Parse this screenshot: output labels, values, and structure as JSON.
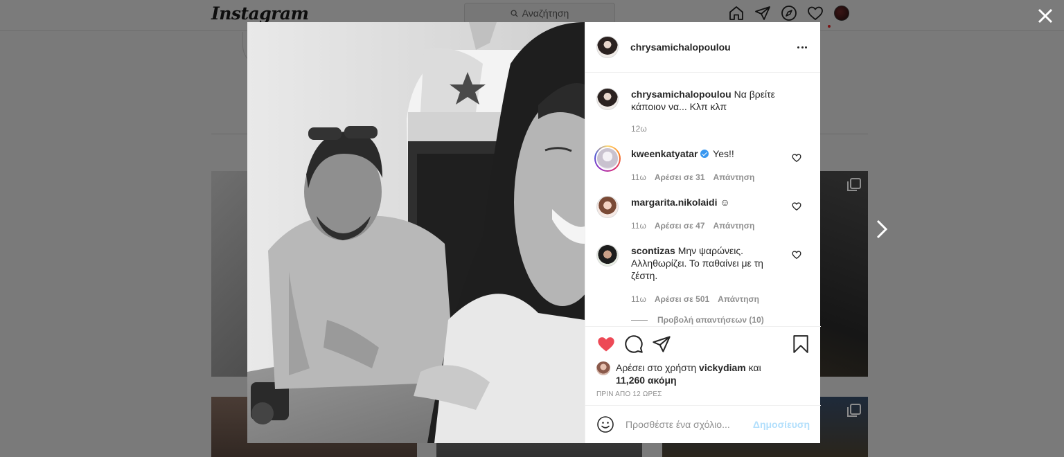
{
  "app": {
    "logo": "Instagram"
  },
  "search": {
    "placeholder": "Αναζήτηση"
  },
  "post": {
    "username": "chrysamichalopoulou",
    "caption": {
      "username": "chrysamichalopoulou",
      "text": "Να βρείτε κάποιον να... Κλπ κλπ",
      "time": "12ω"
    },
    "comments": [
      {
        "username": "kweenkatyatar",
        "verified": true,
        "text": "Yes!!",
        "time": "11ω",
        "likes": "Αρέσει σε 31",
        "reply": "Απάντηση"
      },
      {
        "username": "margarita.nikolaidi",
        "text": "☺",
        "time": "11ω",
        "likes": "Αρέσει σε 47",
        "reply": "Απάντηση"
      },
      {
        "username": "scontizas",
        "text": "Μην ψαρώνεις. Αλληθωρίζει. Το παθαίνει με τη ζέστη.",
        "time": "11ω",
        "likes": "Αρέσει σε 501",
        "reply": "Απάντηση"
      }
    ],
    "view_replies": "Προβολή απαντήσεων (10)",
    "liked_by": {
      "prefix": "Αρέσει στο χρήστη",
      "user": "vickydiam",
      "and": "και",
      "count": "11,260 ακόμη"
    },
    "timestamp": "ΠΡΙΝ ΑΠΟ 12 ΩΡΕΣ",
    "add_comment_placeholder": "Προσθέστε ένα σχόλιο...",
    "post_button": "Δημοσίευση"
  },
  "colors": {
    "like_red": "#ed4956",
    "link_blue": "#b2dffc",
    "verified_blue": "#3897f0"
  }
}
